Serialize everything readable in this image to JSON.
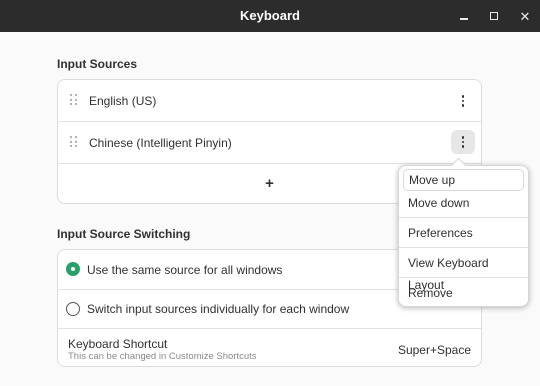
{
  "window": {
    "title": "Keyboard"
  },
  "input_sources": {
    "heading": "Input Sources",
    "items": [
      {
        "label": "English (US)"
      },
      {
        "label": "Chinese (Intelligent Pinyin)"
      }
    ],
    "add_label": "+"
  },
  "switching": {
    "heading": "Input Source Switching",
    "options": [
      {
        "label": "Use the same source for all windows",
        "selected": true
      },
      {
        "label": "Switch input sources individually for each window",
        "selected": false
      }
    ],
    "shortcut": {
      "title": "Keyboard Shortcut",
      "subtitle": "This can be changed in Customize Shortcuts",
      "value": "Super+Space"
    }
  },
  "menu": {
    "items": [
      "Move up",
      "Move down",
      "Preferences",
      "View Keyboard Layout",
      "Remove"
    ]
  },
  "colors": {
    "accent": "#26a269",
    "titlebar": "#2c2c2c"
  }
}
